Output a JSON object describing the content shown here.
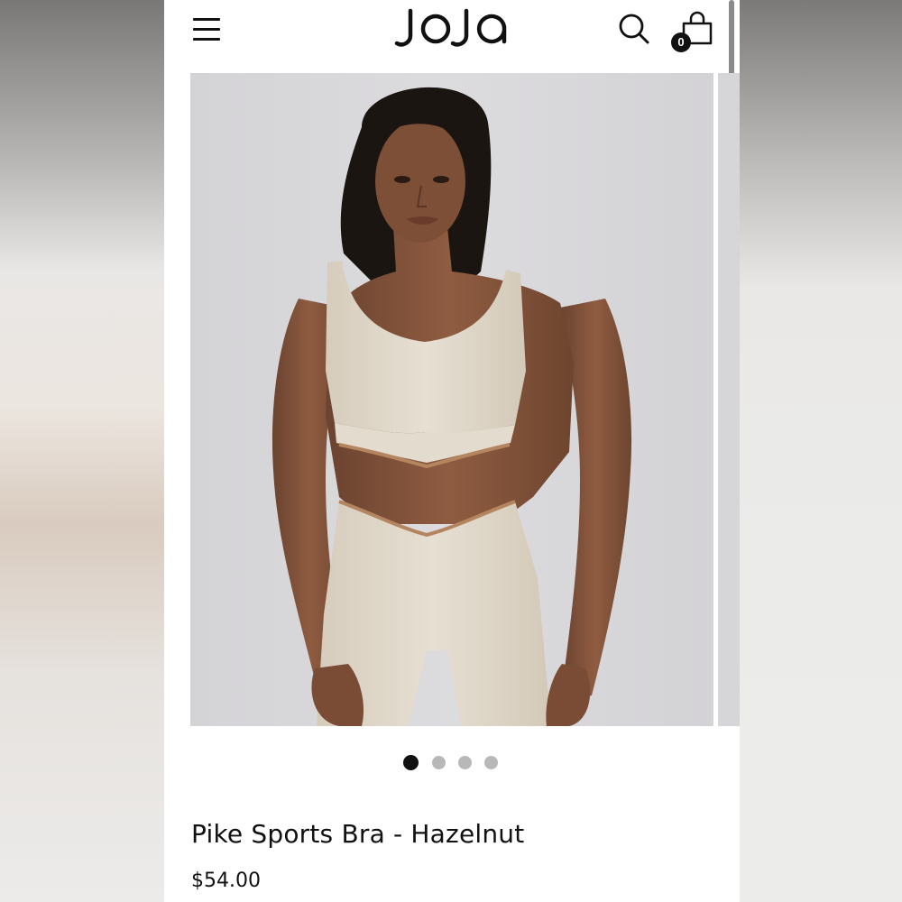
{
  "header": {
    "brand": "JOJA",
    "cart_count": "0",
    "icons": {
      "menu": "hamburger-menu-icon",
      "search": "search-icon",
      "cart": "shopping-bag-icon"
    }
  },
  "gallery": {
    "slides": 4,
    "active_slide": 1,
    "image": "model wearing hazelnut sports bra and leggings"
  },
  "product": {
    "title": "Pike Sports Bra - Hazelnut",
    "price": "$54.00"
  },
  "colors": {
    "text": "#111111",
    "dot_inactive": "#b8b8b8",
    "background": "#ffffff"
  }
}
